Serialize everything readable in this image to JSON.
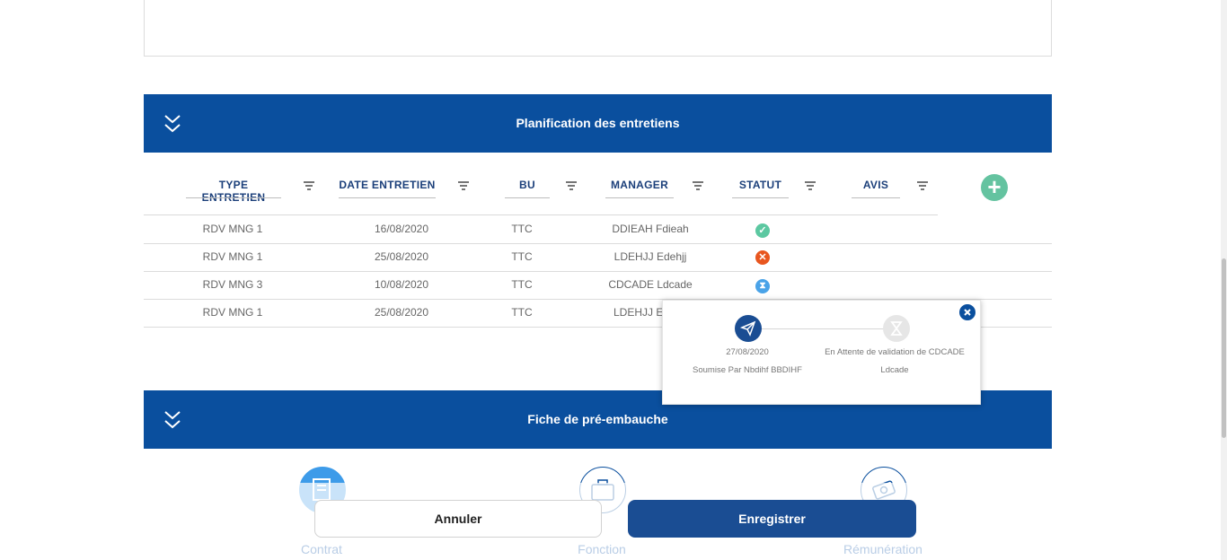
{
  "planning": {
    "title": "Planification des entretiens",
    "columns": [
      "TYPE ENTRETIEN",
      "DATE ENTRETIEN",
      "BU",
      "MANAGER",
      "STATUT",
      "AVIS"
    ],
    "add_label": "+",
    "rows": [
      {
        "type": "RDV MNG 1",
        "date": "16/08/2020",
        "bu": "TTC",
        "manager": "DDIEAH Fdieah",
        "status": "valide",
        "status_glyph": "✓"
      },
      {
        "type": "RDV MNG 1",
        "date": "25/08/2020",
        "bu": "TTC",
        "manager": "LDEHJJ Edehjj",
        "status": "refuse",
        "status_glyph": "✕"
      },
      {
        "type": "RDV MNG 3",
        "date": "10/08/2020",
        "bu": "TTC",
        "manager": "CDCADE Ldcade",
        "status": "en-attente",
        "status_glyph": "⧗"
      },
      {
        "type": "RDV MNG 1",
        "date": "25/08/2020",
        "bu": "TTC",
        "manager": "LDEHJJ E",
        "status": "",
        "status_glyph": ""
      }
    ]
  },
  "status_colors": {
    "valide": "#5cc8a1",
    "refuse": "#e8561f",
    "en-attente": "#4aa3e8"
  },
  "popover": {
    "step1": {
      "date": "27/08/2020",
      "text": "Soumise Par Nbdihf BBDIHF"
    },
    "step2": {
      "line1": "En Attente de validation de CDCADE",
      "line2": "Ldcade"
    }
  },
  "fiche": {
    "title": "Fiche de pré-embauche",
    "steps": [
      "Contrat",
      "Fonction",
      "Rémunération"
    ]
  },
  "actions": {
    "cancel": "Annuler",
    "save": "Enregistrer"
  },
  "colors": {
    "primary": "#0a4f9e",
    "accent_green": "#64c3a0",
    "button_dark": "#1a4d93"
  }
}
